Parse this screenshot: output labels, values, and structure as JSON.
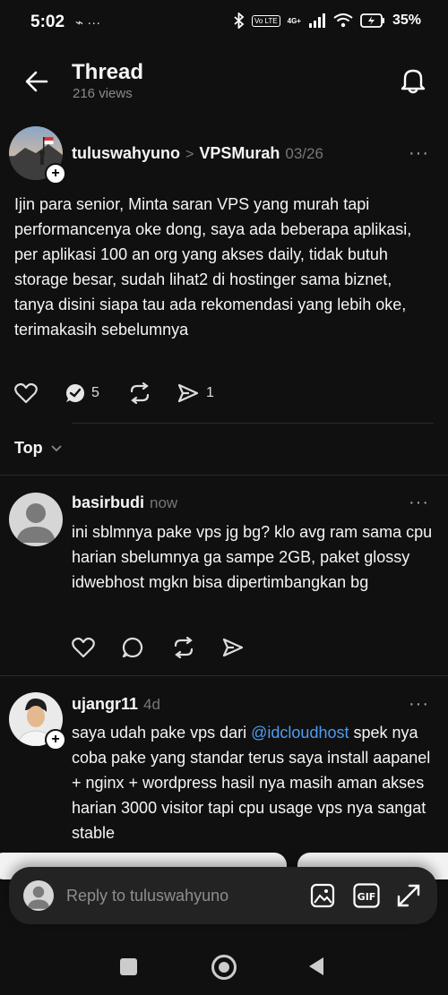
{
  "status_bar": {
    "time": "5:02",
    "left_icons": "⌁ ···",
    "network_badge": "Vo LTE",
    "signal_label": "4G+",
    "battery": "35%"
  },
  "header": {
    "title": "Thread",
    "views": "216 views"
  },
  "main_post": {
    "author": "tuluswahyuno",
    "separator": ">",
    "community": "VPSMurah",
    "date": "03/26",
    "body": "Ijin para senior, Minta saran VPS yang murah tapi performancenya oke dong, saya ada beberapa aplikasi, per aplikasi 100 an org yang akses daily, tidak butuh storage besar, sudah lihat2 di hostinger sama biznet, tanya disini siapa tau ada rekomendasi yang lebih oke, terimakasih sebelumnya",
    "reply_count": "5",
    "share_count": "1"
  },
  "sort": {
    "label": "Top"
  },
  "replies": [
    {
      "author": "basirbudi",
      "time": "now",
      "body": "ini sblmnya pake vps jg bg? klo  avg ram sama cpu harian sbelumnya ga sampe 2GB,  paket glossy idwebhost mgkn bisa dipertimbangkan bg"
    },
    {
      "author": "ujangr11",
      "time": "4d",
      "mention": "@idcloudhost",
      "body_before": "saya udah pake vps dari ",
      "body_after": " spek nya coba pake yang standar terus saya install aapanel + nginx + wordpress hasil nya masih aman akses harian 3000 visitor tapi cpu usage vps nya sangat stable"
    }
  ],
  "reply_bar": {
    "placeholder": "Reply to tuluswahyuno"
  },
  "colors": {
    "background": "#101010",
    "text": "#f3f5f7",
    "muted": "#777777",
    "mention": "#4f9cf2",
    "reply_bar": "#232323"
  },
  "icons": {
    "back": "arrow-left-icon",
    "bell": "bell-icon",
    "like": "heart-icon",
    "comment": "comment-icon",
    "repost": "repost-icon",
    "share": "send-icon",
    "more": "more-icon",
    "image": "image-icon",
    "gif": "gif-icon",
    "expand": "expand-icon"
  }
}
